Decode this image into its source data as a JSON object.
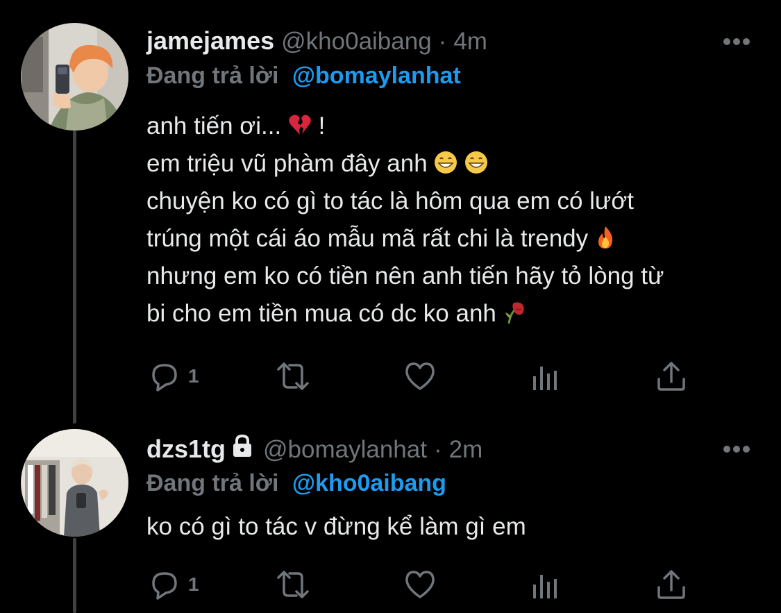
{
  "tweets": [
    {
      "display_name": "jamejames",
      "handle": "@kho0aibang",
      "separator": "·",
      "time": "4m",
      "replying_label": "Đang trả lời",
      "replying_to": "@bomaylanhat",
      "lines": [
        "anh tiến ơi... ",
        "em triệu vũ phàm đây anh ",
        "chuyện ko có gì to tác là hôm qua em có lướt",
        "trúng một cái áo mẫu mã rất chi là trendy ",
        "nhưng em ko có tiền nên anh tiến hãy tỏ lòng từ",
        "bi cho em tiền mua có dc ko anh "
      ],
      "line1_suffix": " !",
      "reply_count": "1",
      "avatar_icon": "profile-photo-orange-hair"
    },
    {
      "display_name": "dzs1tg",
      "protected_icon": "lock-icon",
      "handle": "@bomaylanhat",
      "separator": "·",
      "time": "2m",
      "replying_label": "Đang trả lời",
      "replying_to": "@kho0aibang",
      "lines": [
        "ko có gì to tác v đừng kể làm gì em"
      ],
      "reply_count": "1",
      "avatar_icon": "profile-photo-mirror-selfie"
    }
  ],
  "colors": {
    "background": "#000000",
    "text": "#e7e9ea",
    "muted": "#71767b",
    "accent": "#1d9bf0",
    "thread_line": "#3e4144"
  }
}
